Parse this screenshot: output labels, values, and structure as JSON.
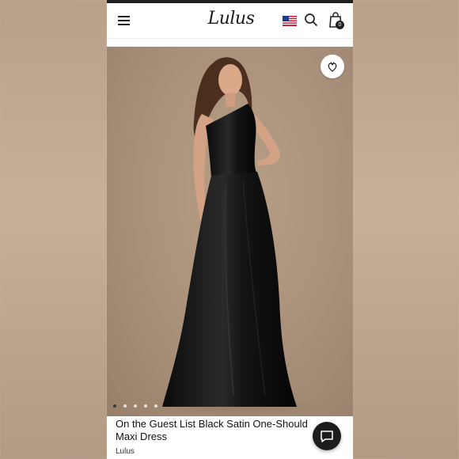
{
  "header": {
    "logo_text": "Lulus",
    "menu_icon": "hamburger-menu-icon",
    "flag_icon": "us-flag-icon",
    "search_icon": "search-icon",
    "bag_icon": "shopping-bag-icon",
    "bag_count": "0"
  },
  "product": {
    "image_alt": "",
    "favorite_icon": "heart-icon",
    "carousel": {
      "count": 5,
      "active_index": 0
    },
    "title_line1": "On the Guest List Black Satin One-Should",
    "title_line2": "Maxi Dress",
    "brand": "Lulus"
  },
  "chat": {
    "icon": "chat-bubble-icon"
  },
  "colors": {
    "background_tan": "#c9b4a1",
    "hero_tan": "#a8907a",
    "dress_black": "#111111",
    "text_dark": "#111111",
    "chat_button": "#1d1d1d"
  }
}
